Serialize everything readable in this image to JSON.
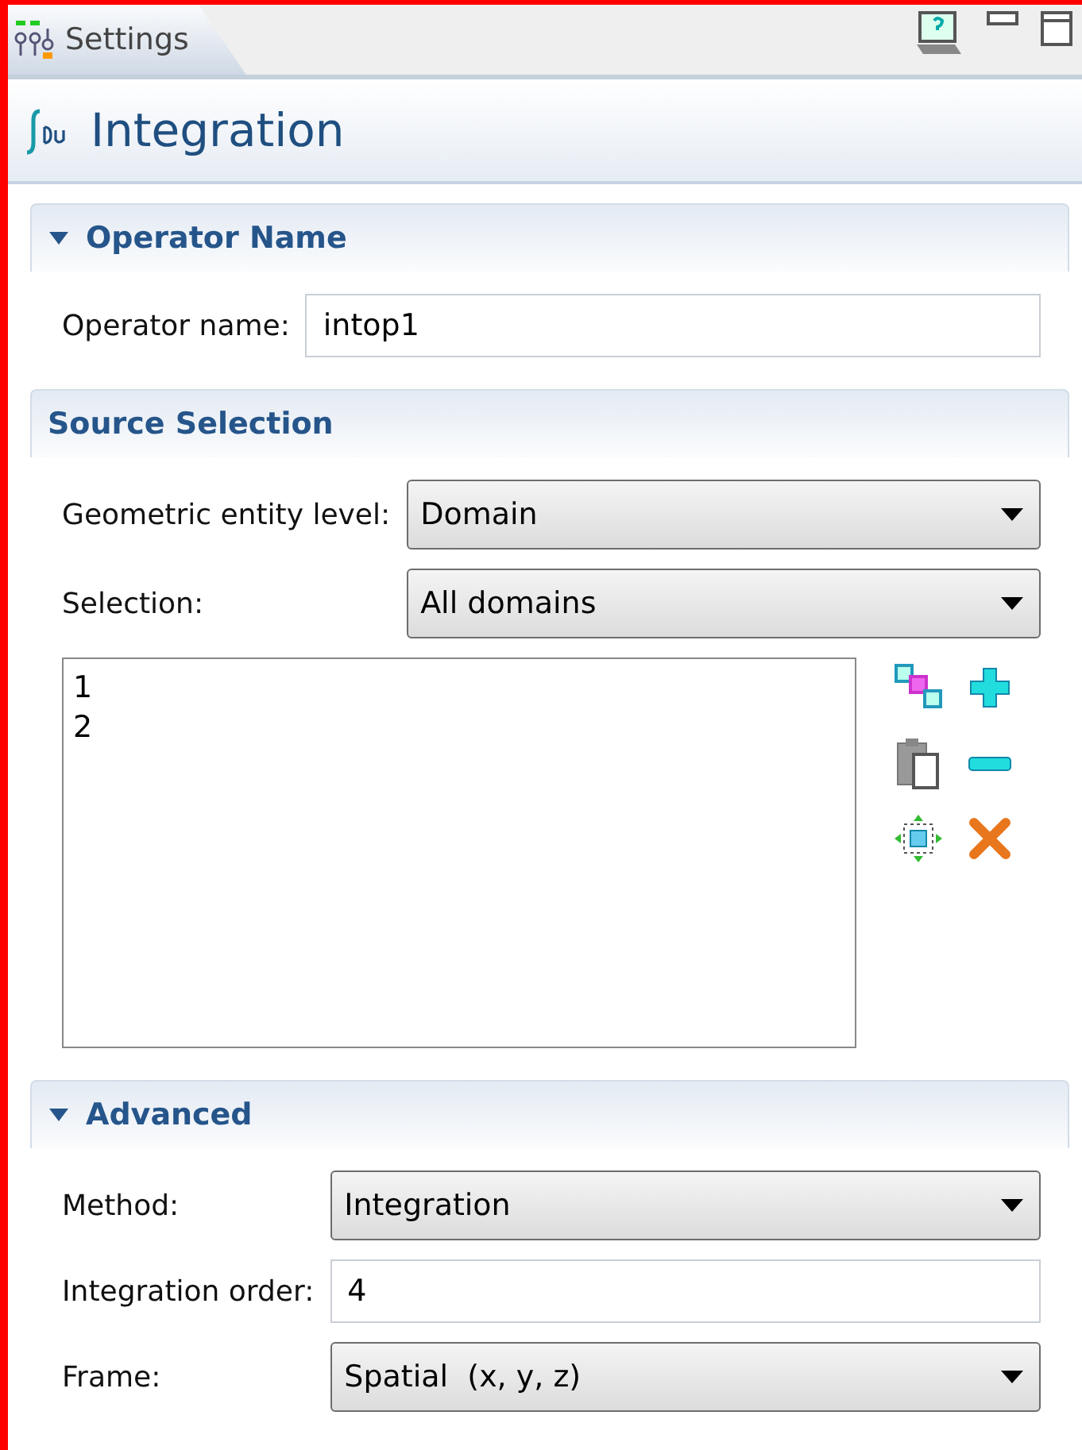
{
  "tab": {
    "label": "Settings",
    "selected": true
  },
  "title": "Integration",
  "sections": [
    {
      "title": "Operator Name",
      "expanded": true,
      "rows": [
        {
          "kind": "text",
          "label": "Operator name:",
          "value": "intop1"
        }
      ]
    },
    {
      "title": "Source Selection",
      "rows": [
        {
          "kind": "select",
          "label": "Geometric entity level:",
          "value": "Domain"
        },
        {
          "kind": "select",
          "label": "Selection:",
          "value": "All domains"
        },
        {
          "kind": "list",
          "items": [
            "1",
            "2"
          ]
        }
      ]
    },
    {
      "title": "Advanced",
      "expanded": true,
      "rows": [
        {
          "kind": "select",
          "label": "Method:",
          "value": "Integration"
        },
        {
          "kind": "text",
          "label": "Integration order:",
          "value": "4"
        },
        {
          "kind": "select",
          "label": "Frame:",
          "value": "Spatial  (x, y, z)"
        }
      ]
    }
  ]
}
